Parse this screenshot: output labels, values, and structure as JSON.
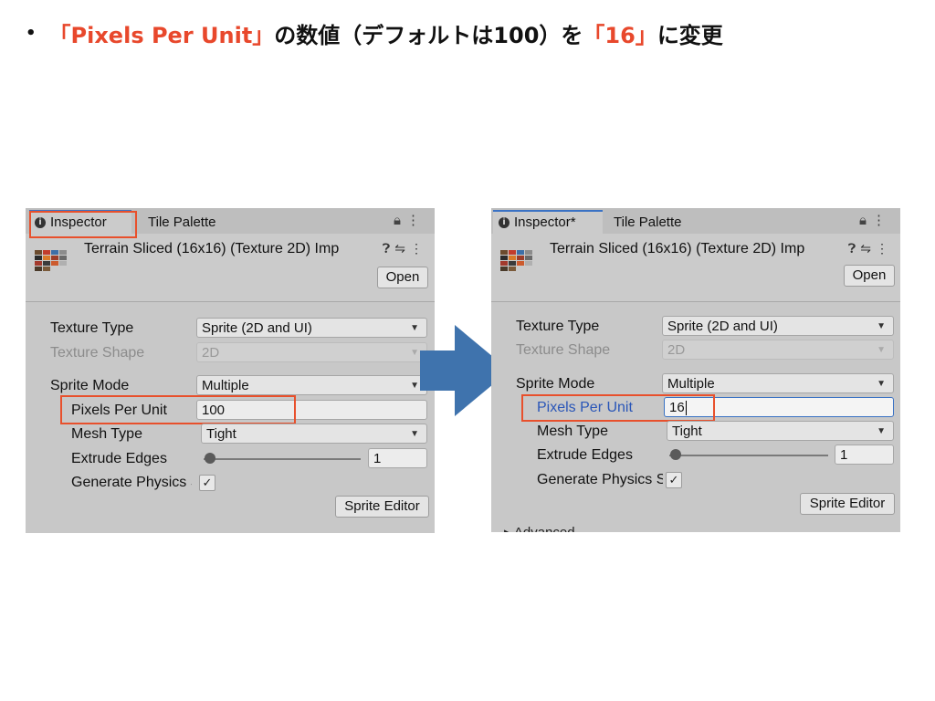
{
  "heading": {
    "bullet": "•",
    "part1": "「Pixels Per Unit」",
    "part2": "の数値（デフォルトは100）を",
    "part3": "「16」",
    "part4": "に変更"
  },
  "colors": {
    "accent": "#e8482c",
    "highlight": "#e8502c",
    "arrow": "#3f73ad",
    "focus": "#3a72c4"
  },
  "before": {
    "tabs": {
      "inspector": "Inspector",
      "tile_palette": "Tile Palette"
    },
    "tab_icons": "lock-icon, kebab-menu-icon",
    "asset_title": "Terrain Sliced (16x16) (Texture 2D) Imp",
    "open_button": "Open",
    "texture_type_label": "Texture Type",
    "texture_type_value": "Sprite (2D and UI)",
    "texture_shape_label": "Texture Shape",
    "texture_shape_value": "2D",
    "sprite_mode_label": "Sprite Mode",
    "sprite_mode_value": "Multiple",
    "ppu_label": "Pixels Per Unit",
    "ppu_value": "100",
    "mesh_type_label": "Mesh Type",
    "mesh_type_value": "Tight",
    "extrude_label": "Extrude Edges",
    "extrude_value": "1",
    "extrude_slider_fraction": 0.03,
    "physics_label": "Generate Physics S",
    "physics_checked": "✓",
    "sprite_editor_button": "Sprite Editor"
  },
  "after": {
    "tabs": {
      "inspector": "Inspector*",
      "tile_palette": "Tile Palette"
    },
    "asset_title": "Terrain Sliced (16x16) (Texture 2D) Imp",
    "open_button": "Open",
    "texture_type_label": "Texture Type",
    "texture_type_value": "Sprite (2D and UI)",
    "texture_shape_label": "Texture Shape",
    "texture_shape_value": "2D",
    "sprite_mode_label": "Sprite Mode",
    "sprite_mode_value": "Multiple",
    "ppu_label": "Pixels Per Unit",
    "ppu_value": "16",
    "mesh_type_label": "Mesh Type",
    "mesh_type_value": "Tight",
    "extrude_label": "Extrude Edges",
    "extrude_value": "1",
    "extrude_slider_fraction": 0.03,
    "physics_label": "Generate Physics S",
    "physics_checked": "✓",
    "sprite_editor_button": "Sprite Editor",
    "advanced_partial": "Advanced"
  }
}
